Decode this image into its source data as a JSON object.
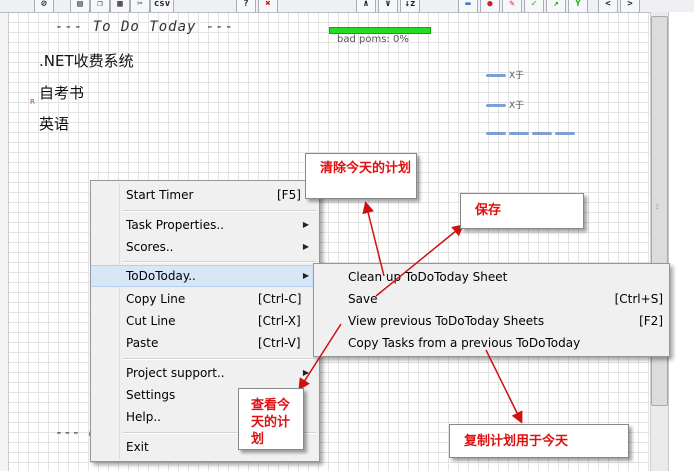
{
  "toolbar": {
    "buttons": [
      {
        "name": "timer-button",
        "glyph": "⊘"
      },
      {
        "name": "new-button",
        "glyph": "▤"
      },
      {
        "name": "copy-button",
        "glyph": "❐"
      },
      {
        "name": "save-button",
        "glyph": "▦"
      },
      {
        "name": "cut-button",
        "glyph": "✂"
      },
      {
        "name": "csv-button",
        "glyph": "csv"
      },
      {
        "name": "help-button",
        "glyph": "?"
      },
      {
        "name": "tools-button",
        "glyph": "✖"
      },
      {
        "name": "sort-button",
        "glyph": "∧"
      },
      {
        "name": "sort-desc-button",
        "glyph": "∨"
      },
      {
        "name": "sort-az-button",
        "glyph": "↓z"
      },
      {
        "name": "stack-button",
        "glyph": "▬"
      },
      {
        "name": "tomato-button",
        "glyph": "●"
      },
      {
        "name": "pin-button",
        "glyph": "✎"
      },
      {
        "name": "check-button",
        "glyph": "✓"
      },
      {
        "name": "arrow-button",
        "glyph": "↗"
      },
      {
        "name": "fork-button",
        "glyph": "Y"
      },
      {
        "name": "prev-button",
        "glyph": "<"
      },
      {
        "name": "next-button",
        "glyph": ">"
      }
    ]
  },
  "sheet": {
    "heading": "--- To Do Today ---",
    "heading_bottom": "--- U",
    "tasks": [
      ".NET收费系统",
      "自考书",
      "英语"
    ],
    "bad_poms": "bad poms: 0%",
    "marks": [
      "X于",
      "X于"
    ]
  },
  "main_menu": {
    "start_timer": "Start Timer",
    "start_timer_key": "[F5]",
    "task_properties": "Task Properties..",
    "scores": "Scores..",
    "todotoday": "ToDoToday..",
    "copy_line": "Copy Line",
    "copy_line_key": "[Ctrl-C]",
    "cut_line": "Cut Line",
    "cut_line_key": "[Ctrl-X]",
    "paste": "Paste",
    "paste_key": "[Ctrl-V]",
    "project_support": "Project support..",
    "settings": "Settings",
    "help": "Help..",
    "exit": "Exit"
  },
  "sub_menu": {
    "clean_up": "Clean up ToDoToday Sheet",
    "save": "Save",
    "save_key": "[Ctrl+S]",
    "view_previous": "View previous ToDoToday Sheets",
    "view_previous_key": "[F2]",
    "copy_tasks": "Copy Tasks from a previous ToDoToday"
  },
  "callouts": {
    "clear": "清除今天的计划",
    "save": "保存",
    "view": "查看今天的计划",
    "copy": "复制计划用于今天"
  },
  "colors": {
    "callout_text": "#e01010",
    "progress": "#22dd22",
    "highlight": "#d8e7f8"
  }
}
